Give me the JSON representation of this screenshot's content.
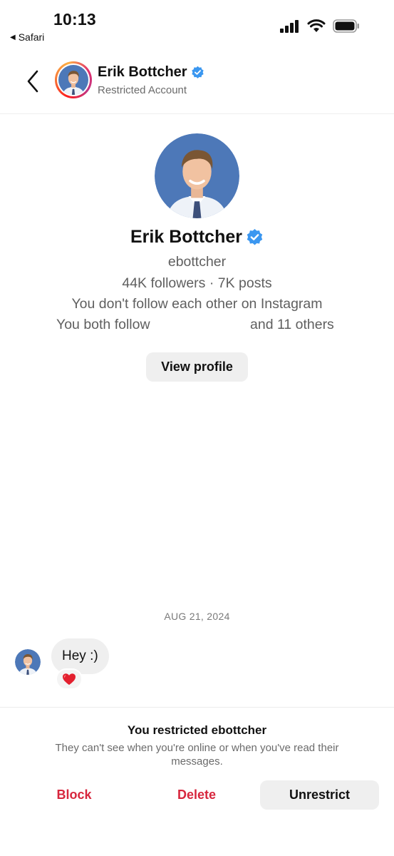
{
  "status_bar": {
    "time": "10:13",
    "back_app": "Safari",
    "icons": [
      "cellular-signal-icon",
      "wifi-icon",
      "battery-icon"
    ]
  },
  "header": {
    "name": "Erik Bottcher",
    "subtitle": "Restricted Account",
    "verified": true
  },
  "profile": {
    "name": "Erik Bottcher",
    "username": "ebottcher",
    "stats": "44K followers · 7K posts",
    "follow_status": "You don't follow each other on Instagram",
    "mutual_prefix": "You both follow",
    "mutual_suffix": "and 11 others",
    "view_profile_label": "View profile"
  },
  "chat": {
    "date": "AUG 21, 2024",
    "messages": [
      {
        "text": "Hey :)",
        "reaction": "heart"
      }
    ]
  },
  "restriction": {
    "title": "You restricted ebottcher",
    "description": "They can't see when you're online or when you've read their messages.",
    "actions": {
      "block": "Block",
      "delete": "Delete",
      "unrestrict": "Unrestrict"
    }
  },
  "colors": {
    "verified": "#3b97f0",
    "destructive": "#d7263d",
    "avatar_bg": "#4d78b8"
  }
}
